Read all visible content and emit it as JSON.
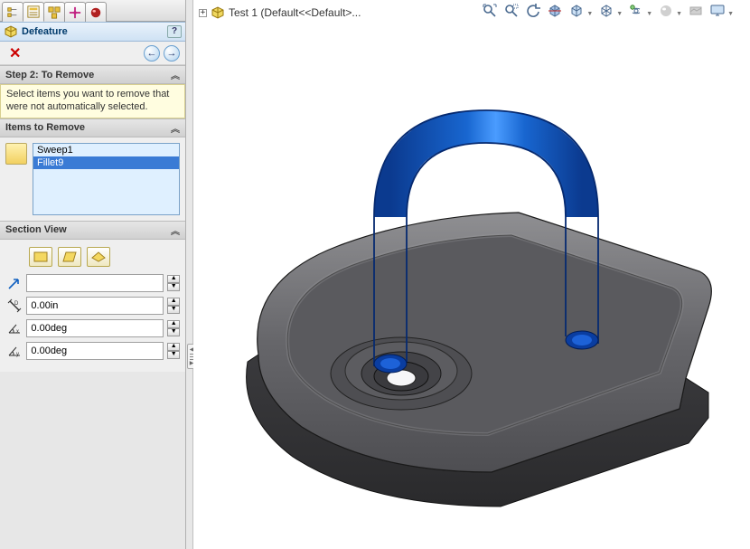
{
  "panel": {
    "title": "Defeature",
    "help_glyph": "?",
    "cancel_glyph": "✕",
    "nav_back_glyph": "←",
    "nav_fwd_glyph": "→"
  },
  "step": {
    "header": "Step 2: To Remove",
    "hint": "Select items you want to remove that were not automatically selected."
  },
  "items": {
    "header": "Items to Remove",
    "list": [
      "Sweep1",
      "Fillet9"
    ],
    "selected_index": 1
  },
  "section_view": {
    "header": "Section View",
    "plane_buttons": [
      "front-plane",
      "right-plane",
      "top-plane"
    ],
    "rows": [
      {
        "icon": "ref-arrow-icon",
        "value": ""
      },
      {
        "icon": "distance-icon",
        "value": "0.00in"
      },
      {
        "icon": "angle-x-icon",
        "value": "0.00deg"
      },
      {
        "icon": "angle-y-icon",
        "value": "0.00deg"
      }
    ]
  },
  "tree": {
    "expand_glyph": "+",
    "label": "Test 1  (Default<<Default>..."
  },
  "view_toolbar": [
    {
      "name": "zoom-to-fit-icon",
      "glyph": "zoomfit",
      "dim": false,
      "caret": false
    },
    {
      "name": "zoom-area-icon",
      "glyph": "zoomarea",
      "dim": false,
      "caret": false
    },
    {
      "name": "prev-view-icon",
      "glyph": "prevview",
      "dim": false,
      "caret": false
    },
    {
      "name": "section-view-tb-icon",
      "glyph": "section",
      "dim": false,
      "caret": false
    },
    {
      "name": "view-orient-icon",
      "glyph": "cube",
      "dim": false,
      "caret": true
    },
    {
      "name": "display-style-icon",
      "glyph": "dispstyle",
      "dim": false,
      "caret": true
    },
    {
      "name": "hide-show-icon",
      "glyph": "eye",
      "dim": false,
      "caret": true
    },
    {
      "name": "appearance-icon",
      "glyph": "sphere",
      "dim": true,
      "caret": true
    },
    {
      "name": "scene-icon",
      "glyph": "scene",
      "dim": true,
      "caret": false
    },
    {
      "name": "render-tools-icon",
      "glyph": "monitor",
      "dim": false,
      "caret": true
    }
  ],
  "colors": {
    "accent_blue": "#3a7bd5",
    "hint_bg": "#fffde0"
  }
}
